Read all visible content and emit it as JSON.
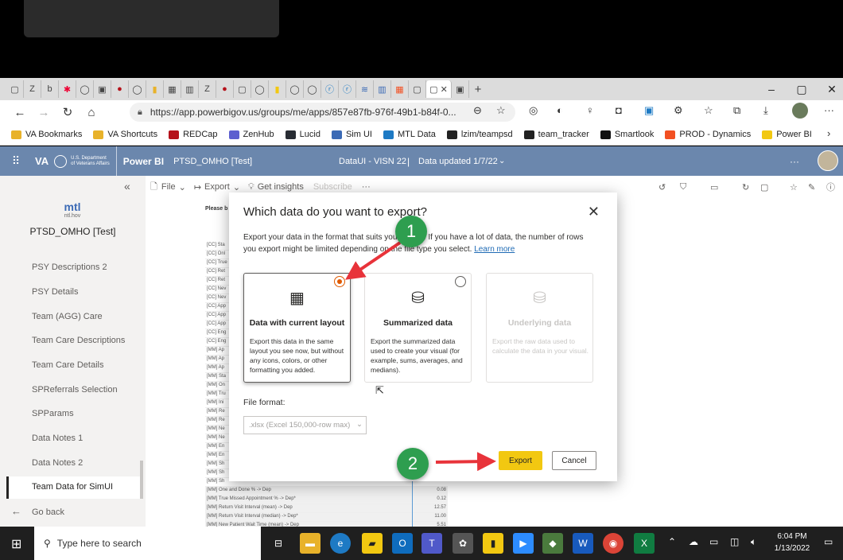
{
  "browser": {
    "url": "https://app.powerbigov.us/groups/me/apps/857e87fb-976f-49b1-b84f-0...",
    "window_controls": [
      "–",
      "▢",
      "✕"
    ],
    "new_tab": "+",
    "bookmarks": [
      {
        "label": "VA Bookmarks",
        "color": "#e8b22a"
      },
      {
        "label": "VA Shortcuts",
        "color": "#e8b22a"
      },
      {
        "label": "REDCap",
        "color": "#b5121b"
      },
      {
        "label": "ZenHub",
        "color": "#5d5fcf"
      },
      {
        "label": "Lucid",
        "color": "#282c33"
      },
      {
        "label": "Sim UI",
        "color": "#3b6ab5"
      },
      {
        "label": "MTL Data",
        "color": "#1e7ac4"
      },
      {
        "label": "lzim/teampsd",
        "color": "#222222"
      },
      {
        "label": "team_tracker",
        "color": "#222222"
      },
      {
        "label": "Smartlook",
        "color": "#111111"
      },
      {
        "label": "PROD - Dynamics",
        "color": "#f25022"
      },
      {
        "label": "Power BI",
        "color": "#f2c811"
      }
    ]
  },
  "powerbi": {
    "va_label": "VA",
    "dept_line1": "U.S. Department",
    "dept_line2": "of Veterans Affairs",
    "app_name": "Power BI",
    "workspace": "PTSD_OMHO [Test]",
    "dataset": "DataUI - VISN 22",
    "separator": "|",
    "updated": "Data updated 1/7/22",
    "menu": {
      "file": "File",
      "export": "Export",
      "insights": "Get insights",
      "subscribe": "Subscribe",
      "more": "···"
    }
  },
  "nav": {
    "logo_text": "mtl",
    "logo_sub": "ntl.hov",
    "app_title": "PTSD_OMHO [Test]",
    "items": [
      "PSY Descriptions 2",
      "PSY Details",
      "Team (AGG) Care",
      "Team Care Descriptions",
      "Team Care Details",
      "SPReferrals Selection",
      "SPParams",
      "Data Notes 1",
      "Data Notes 2",
      "Team Data for SimUI"
    ],
    "go_back": "Go back"
  },
  "report": {
    "please_label": "Please b",
    "rows": [
      {
        "label": "[CC] Sta",
        "value": ""
      },
      {
        "label": "[CC] Onl",
        "value": ""
      },
      {
        "label": "[CC] True",
        "value": ""
      },
      {
        "label": "[CC] Ret",
        "value": ""
      },
      {
        "label": "[CC] Ret",
        "value": ""
      },
      {
        "label": "[CC] Nev",
        "value": ""
      },
      {
        "label": "[CC] Nev",
        "value": ""
      },
      {
        "label": "[CC] App",
        "value": ""
      },
      {
        "label": "[CC] App",
        "value": ""
      },
      {
        "label": "[CC] App",
        "value": ""
      },
      {
        "label": "[CC] Eng",
        "value": ""
      },
      {
        "label": "[CC] Eng",
        "value": ""
      },
      {
        "label": "[MM] Ap",
        "value": ""
      },
      {
        "label": "[MM] Ap",
        "value": ""
      },
      {
        "label": "[MM] Ap",
        "value": ""
      },
      {
        "label": "[MM] Sta",
        "value": ""
      },
      {
        "label": "[MM] On",
        "value": ""
      },
      {
        "label": "[MM] Tru",
        "value": ""
      },
      {
        "label": "[MM] Ini",
        "value": ""
      },
      {
        "label": "[MM] Re",
        "value": ""
      },
      {
        "label": "[MM] Re",
        "value": ""
      },
      {
        "label": "[MM] Ne",
        "value": ""
      },
      {
        "label": "[MM] Ne",
        "value": ""
      },
      {
        "label": "[MM] En",
        "value": ""
      },
      {
        "label": "[MM] En",
        "value": ""
      },
      {
        "label": "[MM] Sh",
        "value": ""
      },
      {
        "label": "[MM] Sh",
        "value": ""
      },
      {
        "label": "[MM] Sh",
        "value": ""
      },
      {
        "label": "[MM] One and Done % -> Dep",
        "value": "0.08"
      },
      {
        "label": "[MM] True Missed Appointment % -> Dep*",
        "value": "0.12"
      },
      {
        "label": "[MM] Return Visit Interval (mean) -> Dep",
        "value": "12.57"
      },
      {
        "label": "[MM] Return Visit Interval (median) -> Dep*",
        "value": "11.00"
      },
      {
        "label": "[MM] New Patient Wait Time (mean) -> Dep",
        "value": "5.51"
      }
    ]
  },
  "dialog": {
    "title": "Which data do you want to export?",
    "desc_part1": "Export your data in the format that suits your needs. If you have a lot of data, the number of rows you export might be limited depending on the file type you select.",
    "learn_more": "Learn more",
    "close": "✕",
    "options": [
      {
        "title": "Data with current layout",
        "desc": "Export this data in the same layout you see now, but without any icons, colors, or other formatting you added.",
        "selected": true
      },
      {
        "title": "Summarized data",
        "desc": "Export the summarized data used to create your visual (for example, sums, averages, and medians).",
        "selected": false
      },
      {
        "title": "Underlying data",
        "desc": "Export the raw data used to calculate the data in your visual.",
        "selected": false,
        "disabled": true
      }
    ],
    "file_format_label": "File format:",
    "file_format_value": ".xlsx (Excel 150,000-row max)",
    "export_button": "Export",
    "cancel_button": "Cancel"
  },
  "annotations": {
    "step1": "1",
    "step2": "2",
    "color": "#2e9e4f",
    "arrow_color": "#e8333a"
  },
  "taskbar": {
    "search_placeholder": "Type here to search",
    "time": "6:04 PM",
    "date": "1/13/2022"
  }
}
